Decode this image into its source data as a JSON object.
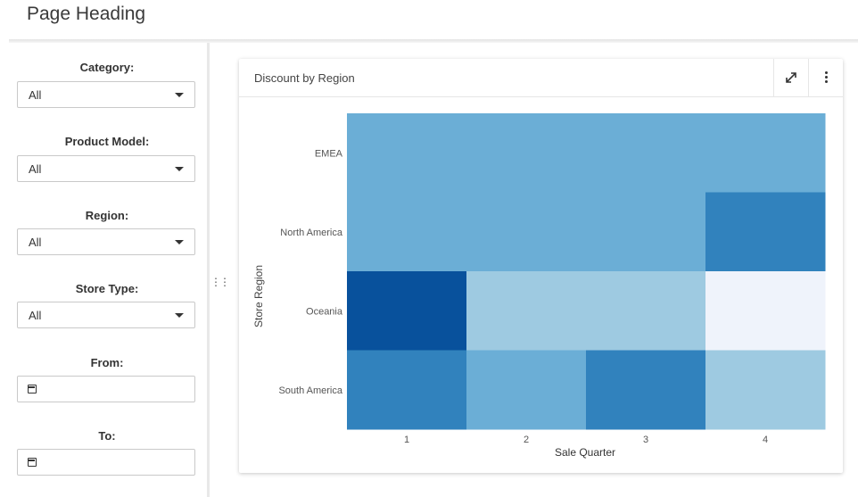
{
  "page": {
    "heading": "Page Heading"
  },
  "filters": {
    "category": {
      "label": "Category:",
      "value": "All"
    },
    "product_model": {
      "label": "Product Model:",
      "value": "All"
    },
    "region": {
      "label": "Region:",
      "value": "All"
    },
    "store_type": {
      "label": "Store Type:",
      "value": "All"
    },
    "from": {
      "label": "From:",
      "value": ""
    },
    "to": {
      "label": "To:",
      "value": ""
    }
  },
  "card": {
    "title": "Discount by Region",
    "expand_icon": "expand-icon",
    "menu_icon": "more-vertical-icon"
  },
  "chart_data": {
    "type": "heatmap",
    "title": "Discount by Region",
    "xlabel": "Sale Quarter",
    "ylabel": "Store Region",
    "x": [
      "1",
      "2",
      "3",
      "4"
    ],
    "y": [
      "EMEA",
      "North America",
      "Oceania",
      "South America"
    ],
    "values": [
      [
        3,
        3,
        3,
        3
      ],
      [
        3,
        3,
        3,
        4
      ],
      [
        5,
        2,
        2,
        1
      ],
      [
        4,
        3,
        4,
        2
      ]
    ],
    "colors": {
      "1": "#eff3fb",
      "2": "#9ecae1",
      "3": "#6baed6",
      "4": "#3182bd",
      "5": "#08519c"
    }
  }
}
